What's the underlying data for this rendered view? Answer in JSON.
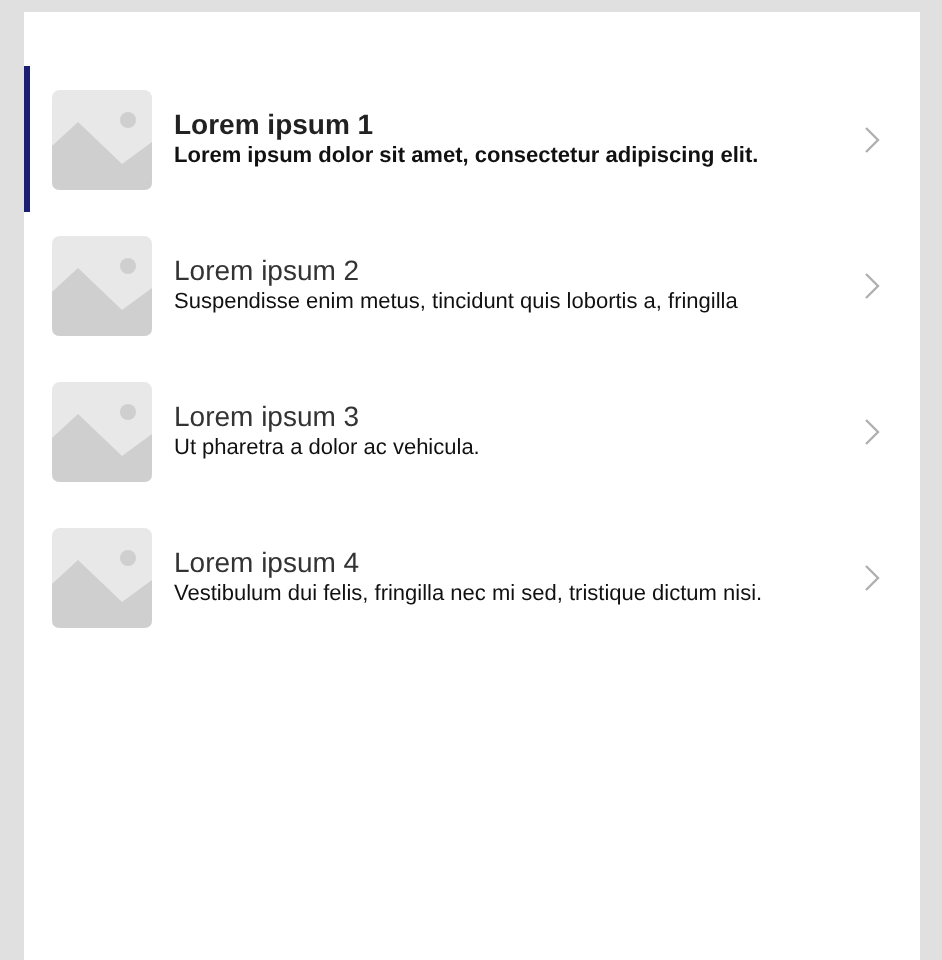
{
  "items": [
    {
      "title": "Lorem ipsum 1",
      "subtitle": "Lorem ipsum dolor sit amet, consectetur adipiscing elit.",
      "selected": true
    },
    {
      "title": "Lorem ipsum 2",
      "subtitle": "Suspendisse enim metus, tincidunt quis lobortis a, fringilla",
      "selected": false
    },
    {
      "title": "Lorem ipsum 3",
      "subtitle": "Ut pharetra a dolor ac vehicula.",
      "selected": false
    },
    {
      "title": "Lorem ipsum 4",
      "subtitle": "Vestibulum dui felis, fringilla nec mi sed, tristique dictum nisi.",
      "selected": false
    }
  ]
}
